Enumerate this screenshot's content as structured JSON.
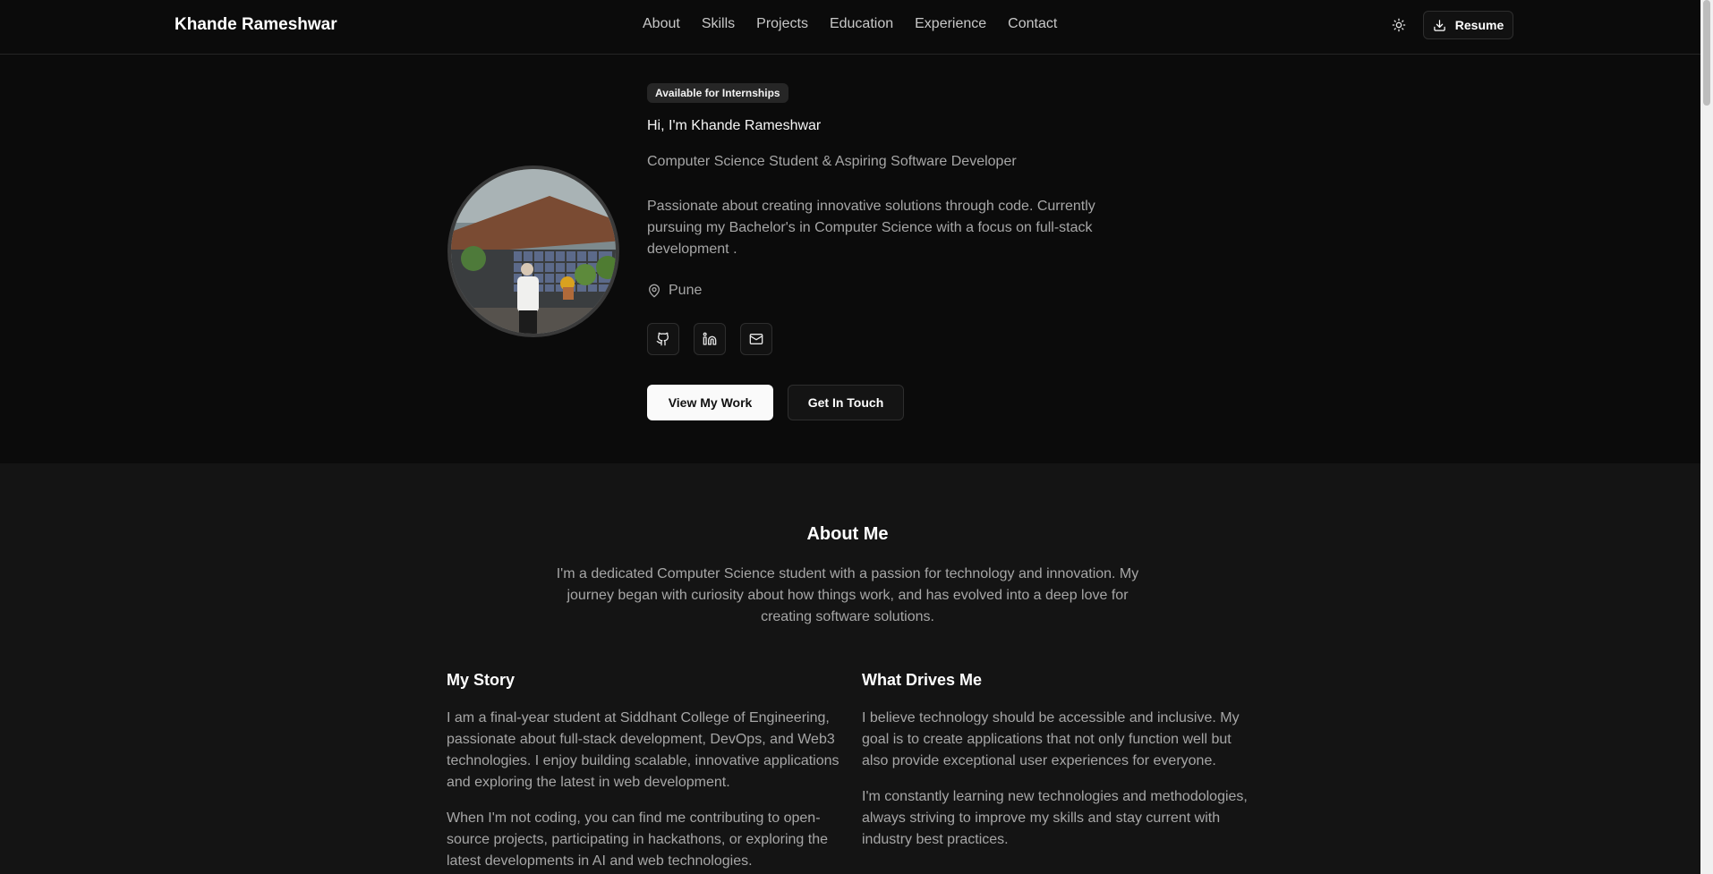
{
  "nav": {
    "brand": "Khande Rameshwar",
    "links": [
      "About",
      "Skills",
      "Projects",
      "Education",
      "Experience",
      "Contact"
    ],
    "theme_icon": "sun-icon",
    "resume_label": "Resume",
    "resume_icon": "download-icon"
  },
  "hero": {
    "badge": "Available for Internships",
    "greeting": "Hi, I'm Khande Rameshwar",
    "role": "Computer Science Student & Aspiring Software Developer",
    "description": "Passionate about creating innovative solutions through code. Currently pursuing my Bachelor's in Computer Science with a focus on full-stack development .",
    "location": "Pune",
    "socials": [
      "github-icon",
      "linkedin-icon",
      "mail-icon"
    ],
    "primary_button": "View My Work",
    "secondary_button": "Get In Touch"
  },
  "about": {
    "title": "About Me",
    "intro": "I'm a dedicated Computer Science student with a passion for technology and innovation. My journey began with curiosity about how things work, and has evolved into a deep love for creating software solutions.",
    "story": {
      "title": "My Story",
      "p1": "I am a final-year student at Siddhant College of Engineering, passionate about full-stack development, DevOps, and Web3 technologies. I enjoy building scalable, innovative applications and exploring the latest in web development.",
      "p2": "When I'm not coding, you can find me contributing to open-source projects, participating in hackathons, or exploring the latest developments in AI and web technologies."
    },
    "drives": {
      "title": "What Drives Me",
      "p1": "I believe technology should be accessible and inclusive. My goal is to create applications that not only function well but also provide exceptional user experiences for everyone.",
      "p2": "I'm constantly learning new technologies and methodologies, always striving to improve my skills and stay current with industry best practices."
    }
  },
  "colors": {
    "background": "#0b0b0b",
    "section_alt": "#141414",
    "text_muted": "#a6a6a6",
    "primary_button_bg": "#fafafa"
  }
}
